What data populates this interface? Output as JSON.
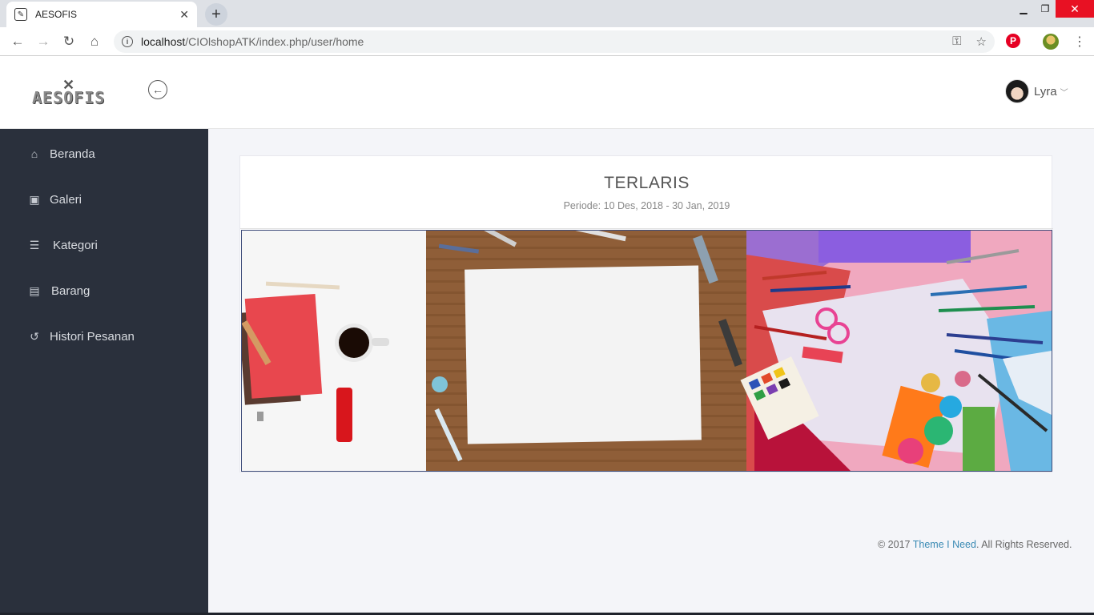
{
  "browser": {
    "tab_title": "AESOFIS",
    "url_host": "localhost",
    "url_path": "/CIOlshopATK/index.php/user/home"
  },
  "header": {
    "logo_text": "AESOFIS",
    "user_name": "Lyra"
  },
  "sidebar": {
    "items": [
      {
        "label": "Beranda",
        "icon": "home-icon"
      },
      {
        "label": "Galeri",
        "icon": "image-icon"
      },
      {
        "label": "Kategori",
        "icon": "list-icon"
      },
      {
        "label": "Barang",
        "icon": "table-icon"
      },
      {
        "label": "Histori Pesanan",
        "icon": "history-icon"
      }
    ]
  },
  "main": {
    "title": "TERLARIS",
    "period": "Periode: 10 Des, 2018 - 30 Jan, 2019"
  },
  "footer": {
    "prefix": "© 2017 ",
    "link": "Theme I Need",
    "suffix": ". All Rights Reserved."
  },
  "colors": {
    "sidebar_bg": "#2a303c",
    "page_bg": "#f4f5f9",
    "link": "#3a8ab4",
    "close_button": "#e81123"
  }
}
